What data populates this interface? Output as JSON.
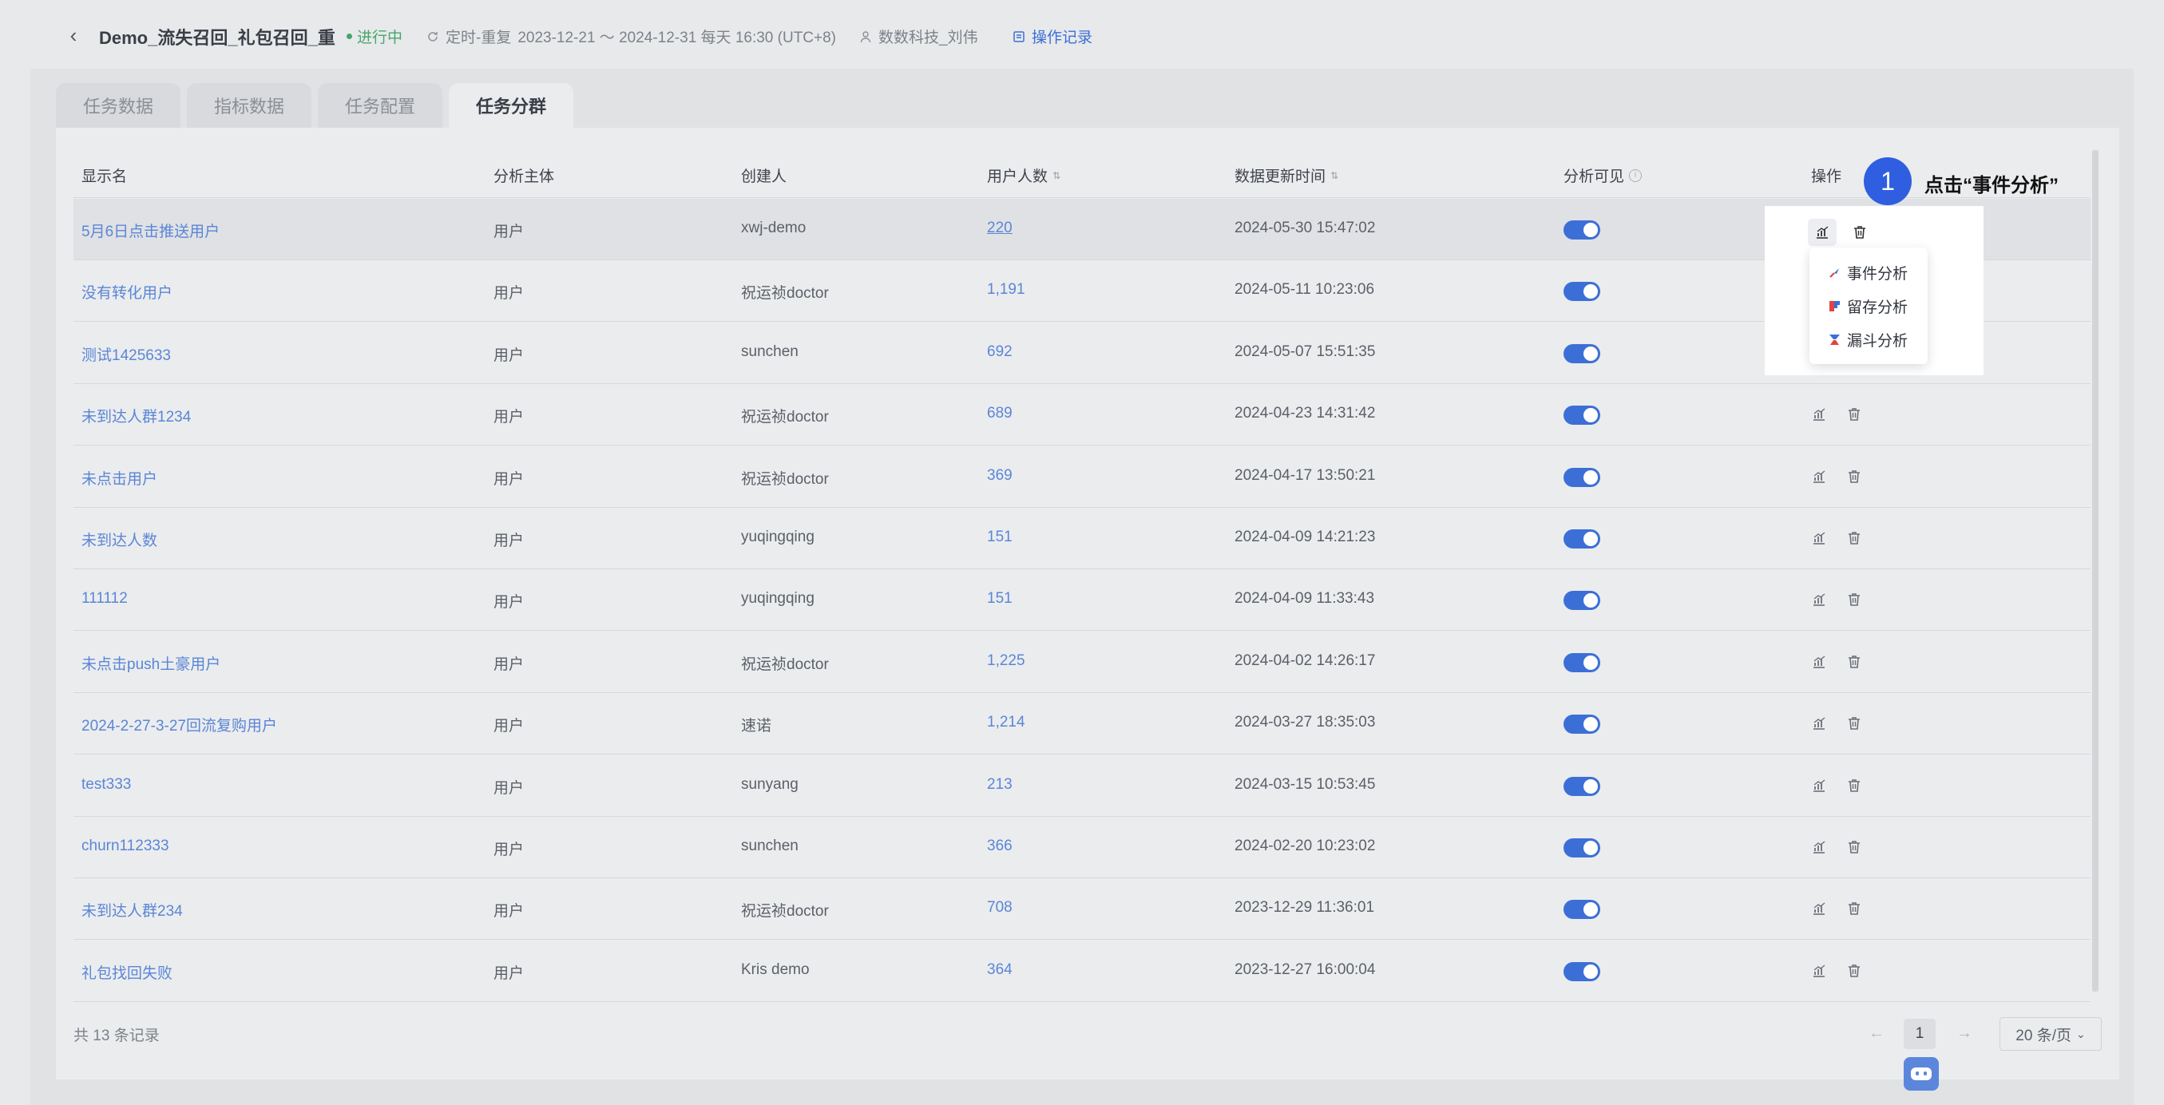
{
  "header": {
    "title": "Demo_流失召回_礼包召回_重",
    "status": "进行中",
    "schedule_type": "定时-重复",
    "schedule_range": "2023-12-21 〜 2024-12-31 每天 16:30 (UTC+8)",
    "owner": "数数科技_刘伟",
    "oplog": "操作记录"
  },
  "tabs": [
    {
      "label": "任务数据"
    },
    {
      "label": "指标数据"
    },
    {
      "label": "任务配置"
    },
    {
      "label": "任务分群"
    }
  ],
  "columns": {
    "name": "显示名",
    "subject": "分析主体",
    "creator": "创建人",
    "count": "用户人数",
    "time": "数据更新时间",
    "visible": "分析可见",
    "ops": "操作"
  },
  "rows": [
    {
      "name": "5月6日点击推送用户",
      "subject": "用户",
      "creator": "xwj-demo",
      "count": "220",
      "time": "2024-05-30 15:47:02"
    },
    {
      "name": "没有转化用户",
      "subject": "用户",
      "creator": "祝运祯doctor",
      "count": "1,191",
      "time": "2024-05-11 10:23:06"
    },
    {
      "name": "测试1425633",
      "subject": "用户",
      "creator": "sunchen",
      "count": "692",
      "time": "2024-05-07 15:51:35"
    },
    {
      "name": "未到达人群1234",
      "subject": "用户",
      "creator": "祝运祯doctor",
      "count": "689",
      "time": "2024-04-23 14:31:42"
    },
    {
      "name": "未点击用户",
      "subject": "用户",
      "creator": "祝运祯doctor",
      "count": "369",
      "time": "2024-04-17 13:50:21"
    },
    {
      "name": "未到达人数",
      "subject": "用户",
      "creator": "yuqingqing",
      "count": "151",
      "time": "2024-04-09 14:21:23"
    },
    {
      "name": "111112",
      "subject": "用户",
      "creator": "yuqingqing",
      "count": "151",
      "time": "2024-04-09 11:33:43"
    },
    {
      "name": "未点击push土豪用户",
      "subject": "用户",
      "creator": "祝运祯doctor",
      "count": "1,225",
      "time": "2024-04-02 14:26:17"
    },
    {
      "name": "2024-2-27-3-27回流复购用户",
      "subject": "用户",
      "creator": "速诺",
      "count": "1,214",
      "time": "2024-03-27 18:35:03"
    },
    {
      "name": "test333",
      "subject": "用户",
      "creator": "sunyang",
      "count": "213",
      "time": "2024-03-15 10:53:45"
    },
    {
      "name": "churn112333",
      "subject": "用户",
      "creator": "sunchen",
      "count": "366",
      "time": "2024-02-20 10:23:02"
    },
    {
      "name": "未到达人群234",
      "subject": "用户",
      "creator": "祝运祯doctor",
      "count": "708",
      "time": "2023-12-29 11:36:01"
    },
    {
      "name": "礼包找回失败",
      "subject": "用户",
      "creator": "Kris demo",
      "count": "364",
      "time": "2023-12-27 16:00:04"
    }
  ],
  "dropdown": [
    {
      "label": "事件分析",
      "icon": "event-analysis-icon"
    },
    {
      "label": "留存分析",
      "icon": "retention-analysis-icon"
    },
    {
      "label": "漏斗分析",
      "icon": "funnel-analysis-icon"
    }
  ],
  "annotation": {
    "step": "1",
    "text": "点击“事件分析”"
  },
  "footer": {
    "total": "共 13 条记录",
    "page": "1",
    "page_size": "20 条/页"
  },
  "colors": {
    "accent": "#3c6fd6",
    "link": "#5a86d6",
    "status_green": "#46a76a",
    "annotation_badge": "#2f5fe0"
  }
}
